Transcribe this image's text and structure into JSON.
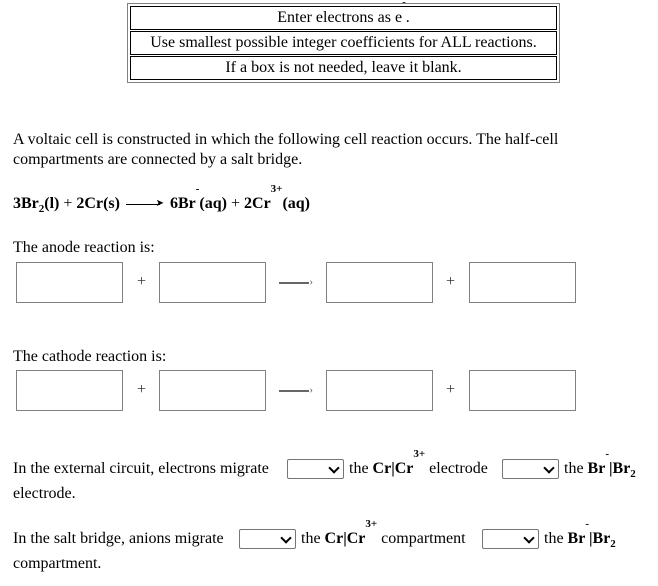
{
  "instructions": {
    "row1_prefix": "Enter electrons as e",
    "row1_sup": "-",
    "row1_suffix": ".",
    "row2": "Use smallest possible integer coefficients for ALL reactions.",
    "row3": "If a box is not needed, leave it blank."
  },
  "intro": "A voltaic cell is constructed in which the following cell reaction occurs. The half-cell compartments are connected by a salt bridge.",
  "cell_reaction": {
    "r1": "3Br",
    "r1_sub": "2",
    "r1_state": "(l)",
    "plus": "+",
    "r2": "2Cr(s)",
    "p1": "6Br",
    "p1_sup": "-",
    "p1_state": "(aq)",
    "p2": "2Cr",
    "p2_sup": "3+",
    "p2_state": "(aq)"
  },
  "anode": {
    "label": "The anode reaction is:",
    "boxes": [
      "",
      "",
      "",
      ""
    ],
    "plus": "+"
  },
  "cathode": {
    "label": "The cathode reaction is:",
    "boxes": [
      "",
      "",
      "",
      ""
    ],
    "plus": "+"
  },
  "external_circuit": {
    "prefix": "In the external circuit, electrons migrate",
    "select1_value": "",
    "mid_the": "the",
    "cr": "Cr|Cr",
    "cr_sup": "3+",
    "mid_word": "electrode",
    "select2_value": "",
    "end_the": "the",
    "br": "Br",
    "br_sup": "-",
    "br2": "|Br",
    "br2_sub": "2",
    "line2": "electrode."
  },
  "salt_bridge": {
    "prefix": "In the salt bridge, anions migrate",
    "select1_value": "",
    "mid_the": "the",
    "cr": "Cr|Cr",
    "cr_sup": "3+",
    "mid_word": "compartment",
    "select2_value": "",
    "end_the": "the",
    "br": "Br",
    "br_sup": "-",
    "br2": "|Br",
    "br2_sub": "2",
    "line2": "compartment."
  }
}
